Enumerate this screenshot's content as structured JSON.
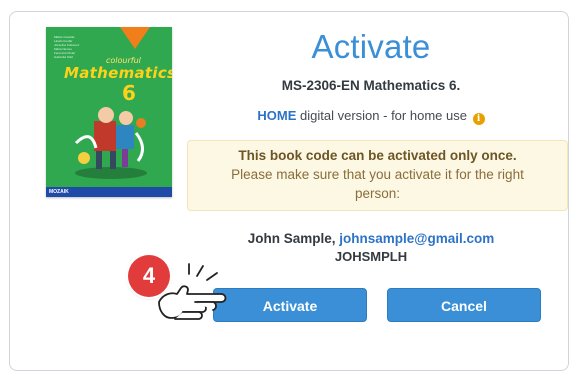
{
  "book": {
    "cover": {
      "publisher": "MOZAIK",
      "series": "colourful",
      "subject": "Mathematics",
      "grade": "6",
      "authors": [
        "Miklós Csordás",
        "Lászlo Konfár",
        "Józsefné Kothencz",
        "Mária Nemes",
        "Ferencné Pintér",
        "Gabriella Sütő"
      ]
    }
  },
  "dialog": {
    "title": "Activate",
    "product_code": "MS-2306-EN Mathematics 6.",
    "version_home": "HOME",
    "version_text": " digital version - for home use ",
    "info_icon": "i",
    "notice_title": "This book code can be activated only once.",
    "notice_text": "Please make sure that you activate it for the right person:",
    "user_name": "John Sample, ",
    "user_email": "johnsample@gmail.com",
    "user_id": "JOHSMPLH",
    "activate_label": "Activate",
    "cancel_label": "Cancel"
  },
  "tutorial": {
    "step_number": "4",
    "pointer_icon": "hand-pointer-icon"
  },
  "colors": {
    "accent": "#3a8fd6",
    "notice_bg": "#fcf8e3",
    "badge": "#e23b3b",
    "cover_bg": "#2fa84f"
  }
}
